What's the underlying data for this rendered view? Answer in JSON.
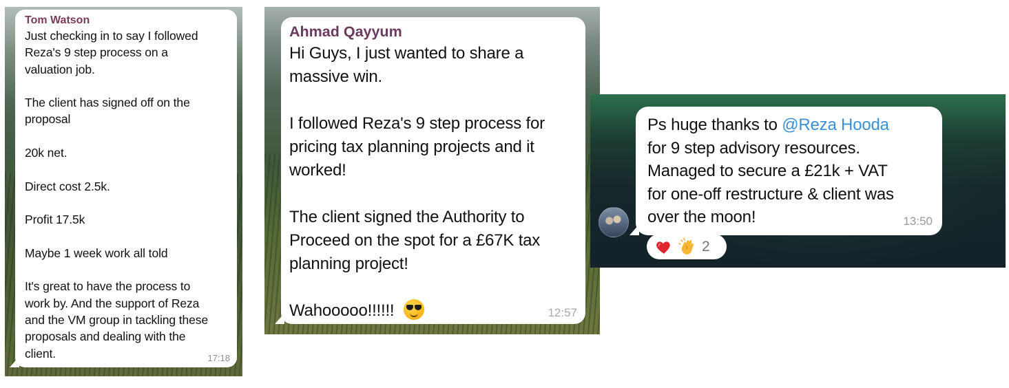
{
  "messages": [
    {
      "sender": "Tom Watson",
      "lines": [
        "Just checking in to say I followed",
        "Reza's 9 step process on a",
        "valuation job.",
        "",
        "The client has signed off on the",
        "proposal",
        "",
        "20k net.",
        "",
        "Direct cost 2.5k.",
        "",
        "Profit 17.5k",
        "",
        "Maybe 1 week work all told",
        "",
        "It's great to have the process to",
        "work by. And the support of Reza",
        "and the VM group in tackling these",
        "proposals and dealing with the",
        "client."
      ],
      "time": "17:18"
    },
    {
      "sender": "Ahmad Qayyum",
      "lines": [
        "Hi Guys, I just wanted to share a",
        "massive win.",
        "",
        "I followed Reza's 9 step process for",
        "pricing tax planning projects and it",
        "worked!",
        "",
        "The client signed the Authority to",
        "Proceed on the spot for a £67K tax",
        "planning project!",
        "",
        "Wahooooo!!!!!!"
      ],
      "emoji": "smiling-face-with-sunglasses",
      "time": "12:57"
    },
    {
      "line1_prefix": "Ps huge thanks to ",
      "mention": "@Reza Hooda",
      "lines": [
        "for 9 step advisory resources.",
        "Managed to secure a £21k + VAT",
        "for one-off restructure & client was",
        "over the moon!"
      ],
      "time": "13:50",
      "reactions": {
        "icons": [
          "heart-icon",
          "clapping-hands-icon"
        ],
        "count": "2"
      }
    }
  ],
  "colors": {
    "sender_1": "#7a3a58",
    "sender_2": "#6b3a5f",
    "mention": "#3a8fd6",
    "bubble": "#ffffff"
  }
}
